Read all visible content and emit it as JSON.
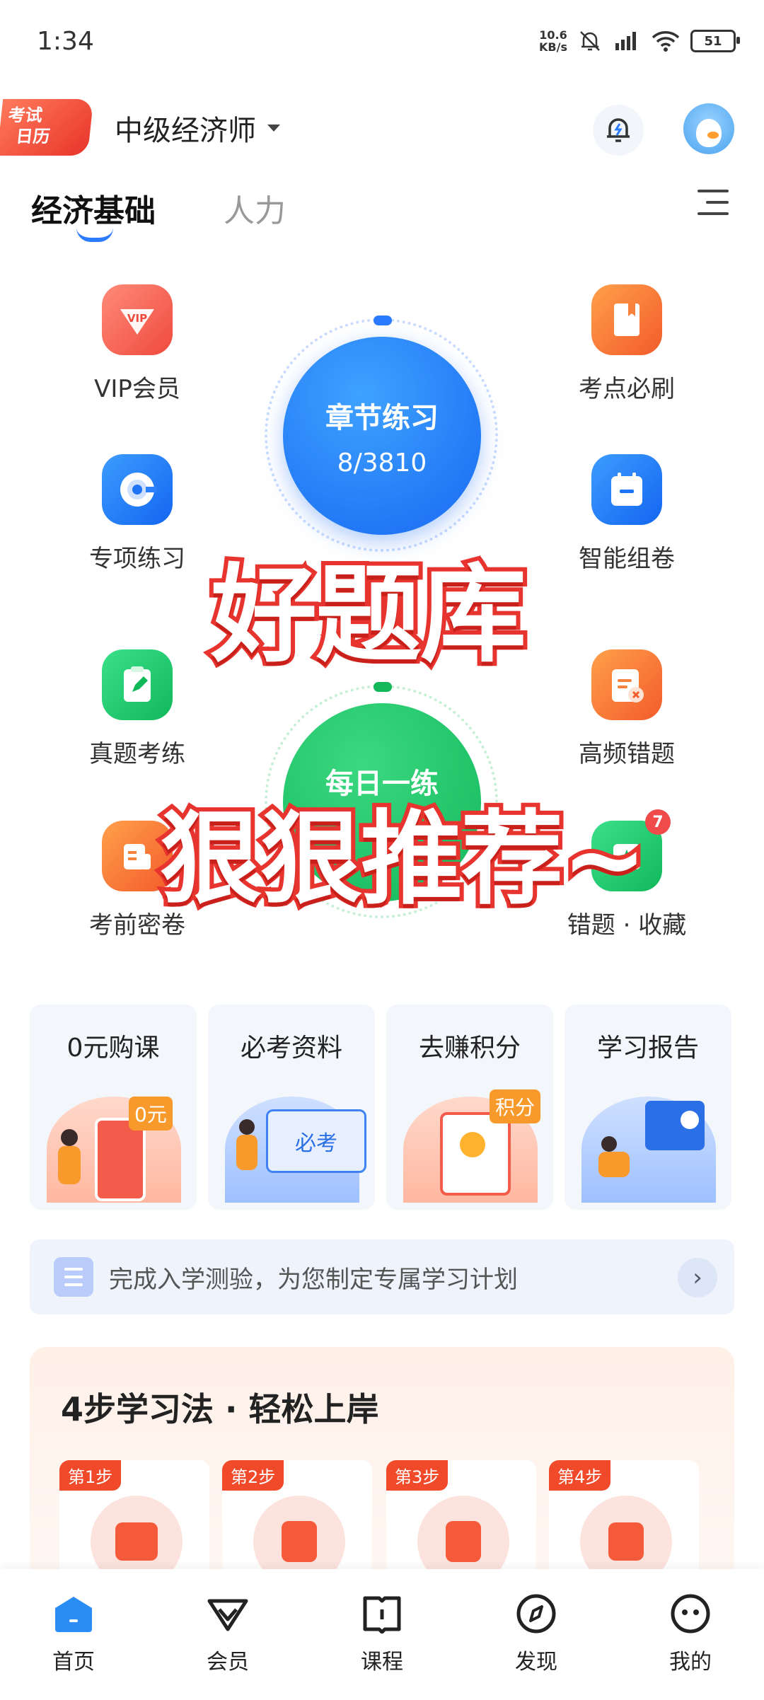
{
  "status_bar": {
    "time": "1:34",
    "net_speed_value": "10.6",
    "net_speed_unit": "KB/s",
    "battery": "51"
  },
  "header": {
    "calendar_badge_line1": "考试",
    "calendar_badge_line2": "日历",
    "exam_name": "中级经济师"
  },
  "tabs": [
    {
      "label": "经济基础",
      "active": true
    },
    {
      "label": "人力",
      "active": false
    }
  ],
  "grid": {
    "vip": "VIP会员",
    "vip_badge": "VIP",
    "points": "考点必刷",
    "special": "专项练习",
    "smart": "智能组卷",
    "real": "真题考练",
    "freq_wrong": "高频错题",
    "mock": "考前密卷",
    "wrong_fav": "错题 · 收藏",
    "wrong_fav_badge": "7"
  },
  "chapter_practice": {
    "title": "章节练习",
    "progress": "8/3810"
  },
  "daily_practice": {
    "title": "每日一练"
  },
  "overlay": {
    "line1": "好题库",
    "line2": "狠狠推荐~"
  },
  "feature_cards": [
    {
      "title": "0元购课",
      "tag": "0元"
    },
    {
      "title": "必考资料",
      "tag": "必考"
    },
    {
      "title": "去赚积分",
      "tag": "积分"
    },
    {
      "title": "学习报告",
      "tag": ""
    }
  ],
  "banner": {
    "text": "完成入学测验，为您制定专属学习计划"
  },
  "steps": {
    "title": "4步学习法 · 轻松上岸",
    "tags": [
      "第1步",
      "第2步",
      "第3步",
      "第4步"
    ]
  },
  "bottom_nav": [
    {
      "label": "首页",
      "active": true
    },
    {
      "label": "会员",
      "active": false
    },
    {
      "label": "课程",
      "active": false
    },
    {
      "label": "发现",
      "active": false
    },
    {
      "label": "我的",
      "active": false
    }
  ],
  "colors": {
    "accent": "#2a7bff",
    "brand_red": "#e8342e",
    "green": "#12b85a"
  }
}
